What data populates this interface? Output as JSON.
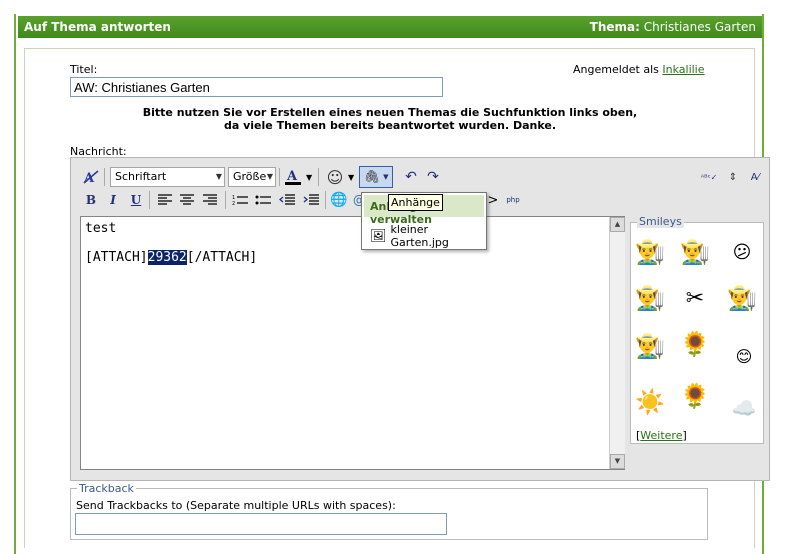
{
  "header": {
    "title": "Auf Thema antworten",
    "topic_label": "Thema:",
    "topic_value": "Christianes Garten"
  },
  "form": {
    "title_label": "Titel:",
    "title_value": "AW: Christianes Garten",
    "logged_in_prefix": "Angemeldet als",
    "logged_in_user": "Inkalilie",
    "notice_line1": "Bitte nutzen Sie vor Erstellen eines neuen Themas die Suchfunktion links oben,",
    "notice_line2": "da viele Themen bereits beantwortet wurden. Danke.",
    "message_label": "Nachricht:"
  },
  "toolbar": {
    "font_select": "Schriftart",
    "size_select": "Größe",
    "bold": "B",
    "italic": "I",
    "underline": "U"
  },
  "editor": {
    "line1": "test",
    "line2_prefix": "[ATTACH]",
    "line2_highlight": "29362",
    "line2_suffix": "[/ATTACH]"
  },
  "attach_menu": {
    "header": "Anhänge verwalten",
    "tooltip": "Anhänge",
    "item": "kleiner Garten.jpg"
  },
  "smileys": {
    "legend": "Smileys",
    "more_open": "[",
    "more_link": "Weitere",
    "more_close": "]"
  },
  "trackback": {
    "legend": "Trackback",
    "label": "Send Trackbacks to (Separate multiple URLs with spaces):",
    "value": ""
  }
}
